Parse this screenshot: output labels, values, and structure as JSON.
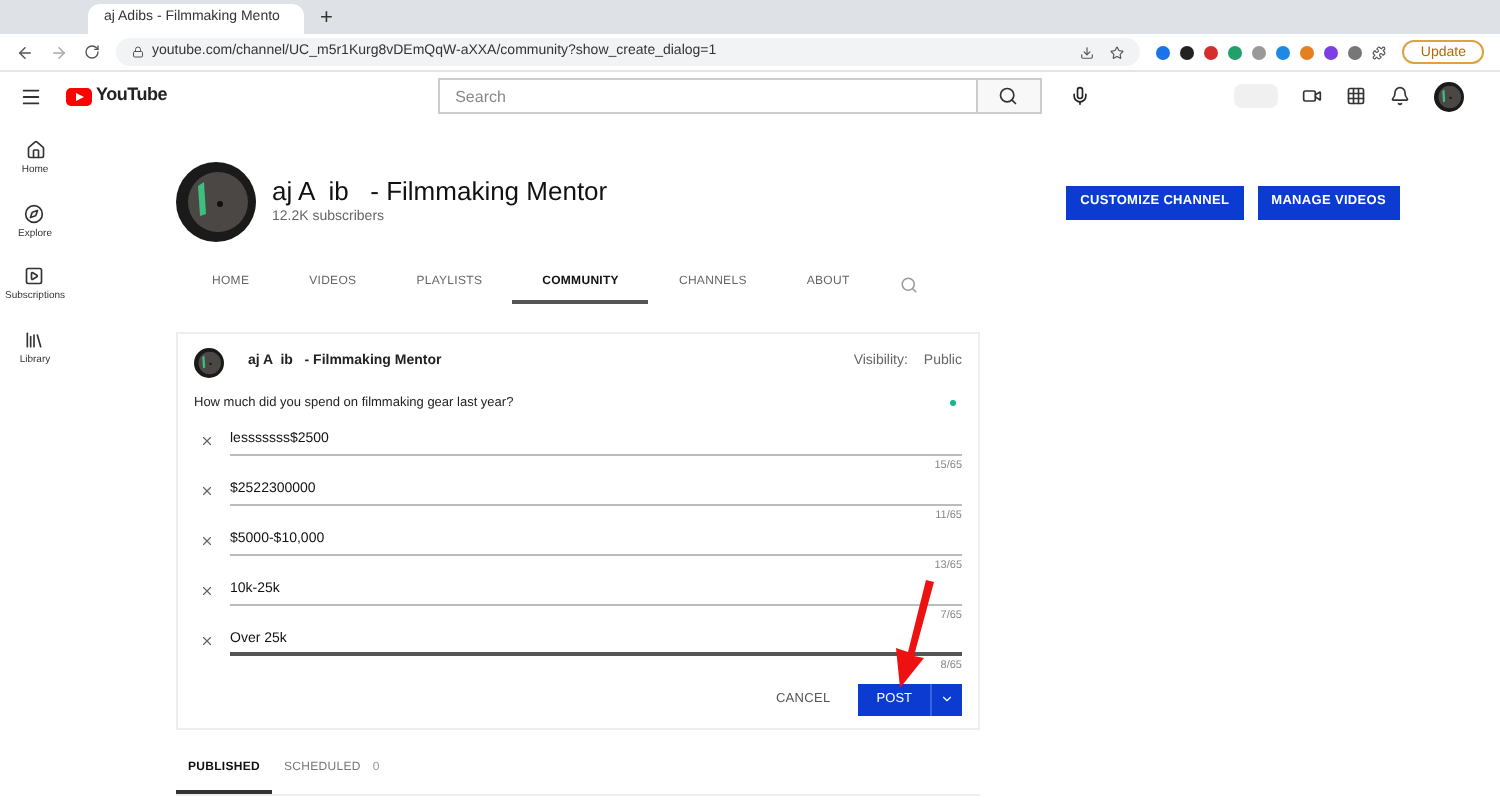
{
  "browser": {
    "tab_title": "aj Adibs - Filmmaking Mento",
    "new_tab": "+",
    "url": "youtube.com/channel/UC_m5r1Kurg8vDEmQqW-aXXA/community?show_create_dialog=1",
    "update_button": "Update"
  },
  "header": {
    "logo": "YouTube",
    "search": {
      "placeholder": "Search"
    }
  },
  "sidebar": {
    "items": [
      {
        "label": "Home"
      },
      {
        "label": "Explore"
      },
      {
        "label": "Subscriptions"
      },
      {
        "label": "Library"
      }
    ]
  },
  "channel": {
    "name": "aj A  ib   - Filmmaking Mentor",
    "subscribers": "12.2K subscribers",
    "buttons": [
      "CUSTOMIZE CHANNEL",
      "MANAGE VIDEOS"
    ]
  },
  "tabs": [
    {
      "label": "HOME",
      "selected": false
    },
    {
      "label": "VIDEOS",
      "selected": false
    },
    {
      "label": "PLAYLISTS",
      "selected": false
    },
    {
      "label": "COMMUNITY",
      "selected": true
    },
    {
      "label": "CHANNELS",
      "selected": false
    },
    {
      "label": "ABOUT",
      "selected": false
    }
  ],
  "post_editor": {
    "author": "aj A  ib   - Filmmaking Mentor",
    "visibility_label": "Visibility:",
    "visibility": "Public",
    "question": "How much did you spend on filmmaking gear last year?",
    "options": [
      {
        "value": "lesssssss$2500",
        "counter": "15/65",
        "focused": false
      },
      {
        "value": "$2522300000",
        "counter": "11/65",
        "focused": false
      },
      {
        "value": "$5000-$10,000",
        "counter": "13/65",
        "focused": false
      },
      {
        "value": "10k-25k",
        "counter": "7/65",
        "focused": false
      },
      {
        "value": "Over 25k",
        "counter": "8/65",
        "focused": true
      }
    ],
    "cancel": "CANCEL",
    "post": "POST"
  },
  "post_tabs": [
    {
      "label": "PUBLISHED",
      "selected": true
    },
    {
      "label": "SCHEDULED",
      "count": "0",
      "selected": false
    }
  ]
}
